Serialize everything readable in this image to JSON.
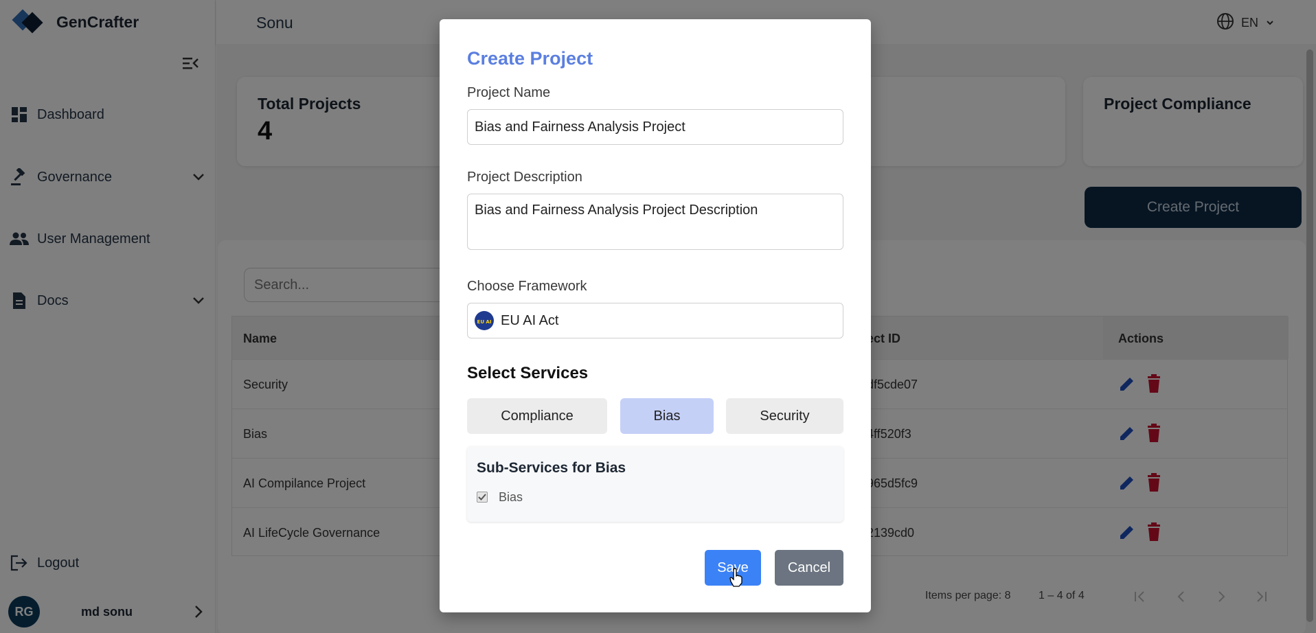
{
  "app": {
    "name": "GenCrafter"
  },
  "sidebar": {
    "items": [
      {
        "label": "Dashboard",
        "icon": "dashboard-icon"
      },
      {
        "label": "Governance",
        "icon": "gavel-icon"
      },
      {
        "label": "User Management",
        "icon": "people-icon"
      },
      {
        "label": "Docs",
        "icon": "document-icon"
      }
    ],
    "logout_label": "Logout",
    "user": {
      "initials": "RG",
      "name": "md sonu"
    }
  },
  "header": {
    "title": "Sonu",
    "language": "EN"
  },
  "stats": {
    "total_projects_label": "Total Projects",
    "total_projects_value": "4",
    "compliance_label": "Project Compliance"
  },
  "create_project_button": "Create Project",
  "search": {
    "placeholder": "Search..."
  },
  "table": {
    "headers": {
      "name": "Name",
      "id": "ect ID",
      "actions": "Actions"
    },
    "rows": [
      {
        "name": "Security",
        "id": "df5cde07"
      },
      {
        "name": "Bias",
        "id": "4ff520f3"
      },
      {
        "name": "AI Compilance Project",
        "id": "965d5fc9"
      },
      {
        "name": "AI LifeCycle Governance",
        "id": "2139cd0"
      }
    ]
  },
  "pagination": {
    "items_per_page": "Items per page:  8",
    "range": "1 – 4 of 4"
  },
  "modal": {
    "title": "Create Project",
    "project_name_label": "Project Name",
    "project_name_value": "Bias and Fairness Analysis Project",
    "project_description_label": "Project Description",
    "project_description_value": "Bias and Fairness Analysis Project Description",
    "framework_label": "Choose Framework",
    "framework_value": "EU AI Act",
    "framework_flag_text": "EU AI",
    "services_title": "Select Services",
    "services": [
      "Compliance",
      "Bias",
      "Security"
    ],
    "selected_service": "Bias",
    "sub_services_title": "Sub-Services for Bias",
    "sub_services": [
      {
        "label": "Bias",
        "checked": true
      }
    ],
    "save_label": "Save",
    "cancel_label": "Cancel"
  },
  "colors": {
    "accent": "#5b7fe0",
    "primary_dark": "#0e2a47",
    "save": "#3b82f6",
    "cancel": "#6b7480",
    "selected_service": "#c5d0f7",
    "delete": "#c8102e",
    "edit": "#1f4fbf"
  }
}
